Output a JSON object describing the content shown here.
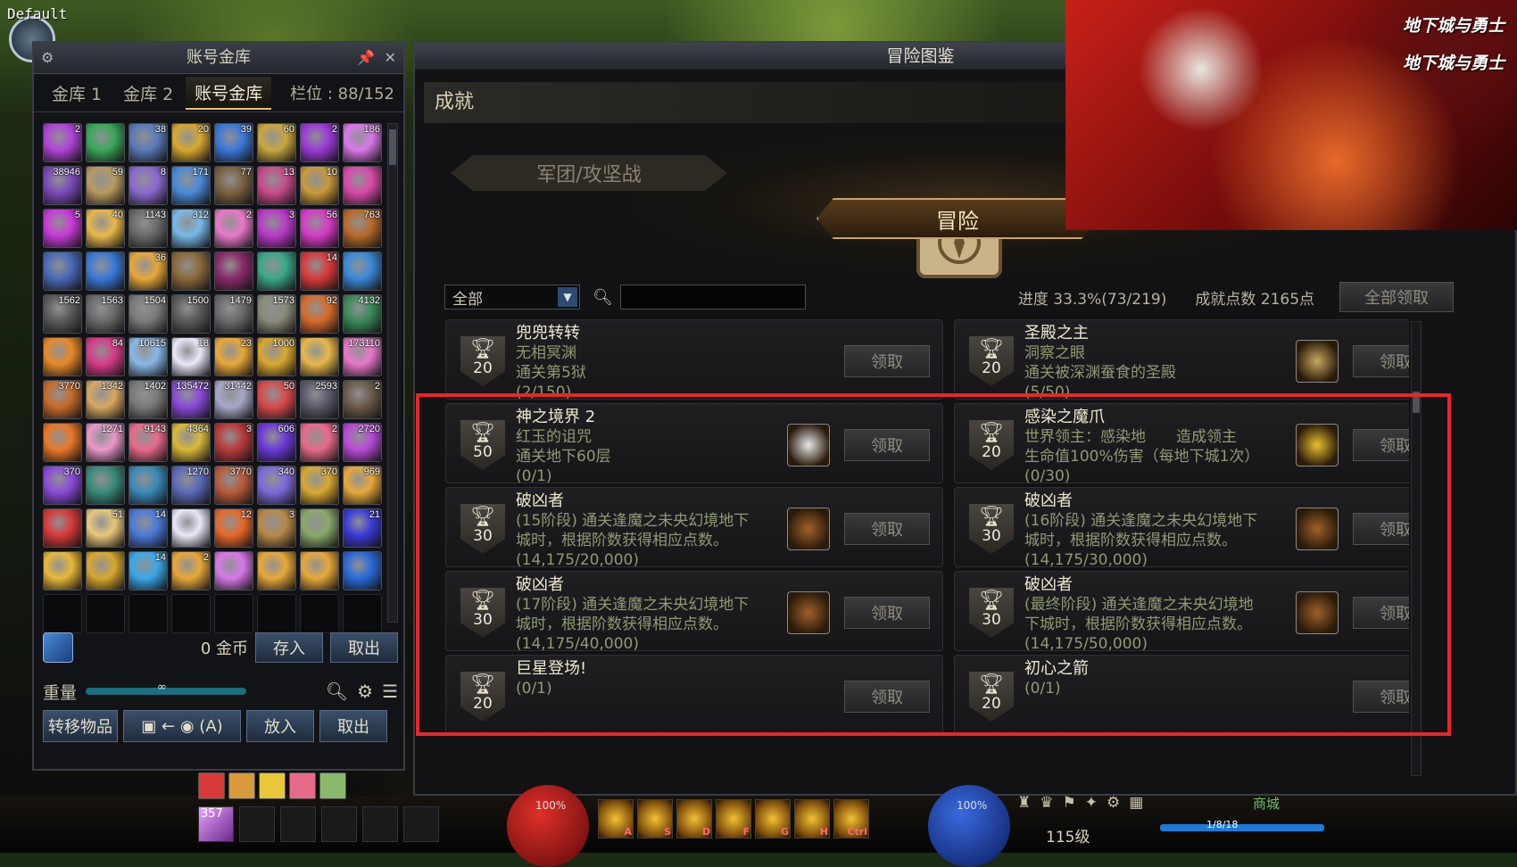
{
  "overlay": {
    "profile_tag": "Default",
    "logo_1": "地下城与勇士",
    "logo_2": "地下城与勇士"
  },
  "vault": {
    "title": "账号金库",
    "tabs": [
      "金库 1",
      "金库 2",
      "账号金库"
    ],
    "active_tab": 2,
    "slot_label": "栏位 : 88/152",
    "items": [
      {
        "n": "2",
        "c": "#b044d8"
      },
      {
        "n": "",
        "c": "#3aa85a"
      },
      {
        "n": "38",
        "c": "#5a7ab8"
      },
      {
        "n": "20",
        "c": "#d8a830"
      },
      {
        "n": "39",
        "c": "#3a78d8"
      },
      {
        "n": "60",
        "c": "#c8a840"
      },
      {
        "n": "2",
        "c": "#9a3ad8"
      },
      {
        "n": "186",
        "c": "#d878e8"
      },
      {
        "n": "38946",
        "c": "#7a4ab8"
      },
      {
        "n": "59",
        "c": "#b89a60"
      },
      {
        "n": "8",
        "c": "#8a6ad0"
      },
      {
        "n": "171",
        "c": "#4a8ad8"
      },
      {
        "n": "77",
        "c": "#7a6040"
      },
      {
        "n": "13",
        "c": "#c84a8a"
      },
      {
        "n": "10",
        "c": "#c89a3a"
      },
      {
        "n": "",
        "c": "#d84aa8"
      },
      {
        "n": "5",
        "c": "#c83ad8"
      },
      {
        "n": "40",
        "c": "#e8b84a"
      },
      {
        "n": "1143",
        "c": "#6a6a6a"
      },
      {
        "n": "312",
        "c": "#7ab8e8"
      },
      {
        "n": "2",
        "c": "#e878c8"
      },
      {
        "n": "3",
        "c": "#b83ac8"
      },
      {
        "n": "56",
        "c": "#d83ac8"
      },
      {
        "n": "763",
        "c": "#b86a2a"
      },
      {
        "n": "",
        "c": "#4a6ab8"
      },
      {
        "n": "",
        "c": "#3a7ad8"
      },
      {
        "n": "36",
        "c": "#e8a83a"
      },
      {
        "n": "",
        "c": "#8a6a3a"
      },
      {
        "n": "",
        "c": "#8a2a6a"
      },
      {
        "n": "",
        "c": "#3aa88a"
      },
      {
        "n": "14",
        "c": "#d83a3a"
      },
      {
        "n": "",
        "c": "#3a8ad8"
      },
      {
        "n": "1562",
        "c": "#5a5a5a"
      },
      {
        "n": "1563",
        "c": "#6a6a6a"
      },
      {
        "n": "1504",
        "c": "#7a7a7a"
      },
      {
        "n": "1500",
        "c": "#5a5a5a"
      },
      {
        "n": "1479",
        "c": "#6a6a6a"
      },
      {
        "n": "1573",
        "c": "#8a8a7a"
      },
      {
        "n": "92",
        "c": "#d86a2a"
      },
      {
        "n": "4132",
        "c": "#3a8a5a"
      },
      {
        "n": "",
        "c": "#e88a2a"
      },
      {
        "n": "84",
        "c": "#d83a8a"
      },
      {
        "n": "10615",
        "c": "#8ab8e8"
      },
      {
        "n": "18",
        "c": "#e8e8f8"
      },
      {
        "n": "23",
        "c": "#e8a83a"
      },
      {
        "n": "1000",
        "c": "#d8a830"
      },
      {
        "n": "",
        "c": "#e8b84a"
      },
      {
        "n": "173110",
        "c": "#e878c8"
      },
      {
        "n": "3770",
        "c": "#c86a2a"
      },
      {
        "n": "1342",
        "c": "#d8a860"
      },
      {
        "n": "1402",
        "c": "#7a7a7a"
      },
      {
        "n": "135472",
        "c": "#8a4ad8"
      },
      {
        "n": "31442",
        "c": "#a8a8c8"
      },
      {
        "n": "50",
        "c": "#d84a4a"
      },
      {
        "n": "2593",
        "c": "#5a5a6a"
      },
      {
        "n": "2",
        "c": "#6a5a4a"
      },
      {
        "n": "",
        "c": "#e8782a"
      },
      {
        "n": "1271",
        "c": "#e898c8"
      },
      {
        "n": "9143",
        "c": "#e86a8a"
      },
      {
        "n": "4364",
        "c": "#d8b83a"
      },
      {
        "n": "3",
        "c": "#b83a3a"
      },
      {
        "n": "606",
        "c": "#6a3ad8"
      },
      {
        "n": "2",
        "c": "#e86a8a"
      },
      {
        "n": "2720",
        "c": "#b84ad8"
      },
      {
        "n": "370",
        "c": "#8a4ad8"
      },
      {
        "n": "",
        "c": "#3a8a7a"
      },
      {
        "n": "",
        "c": "#3a8ab8"
      },
      {
        "n": "1270",
        "c": "#5a6ab8"
      },
      {
        "n": "3770",
        "c": "#b85a3a"
      },
      {
        "n": "340",
        "c": "#7a6ad8"
      },
      {
        "n": "370",
        "c": "#d8a830"
      },
      {
        "n": "969",
        "c": "#e8a83a"
      },
      {
        "n": "",
        "c": "#d83a3a"
      },
      {
        "n": "51",
        "c": "#e8c87a"
      },
      {
        "n": "14",
        "c": "#4a7ad8"
      },
      {
        "n": "",
        "c": "#e8e8f8"
      },
      {
        "n": "12",
        "c": "#e8682a"
      },
      {
        "n": "3",
        "c": "#b8884a"
      },
      {
        "n": "",
        "c": "#8aa86a"
      },
      {
        "n": "21",
        "c": "#3a3ad8"
      },
      {
        "n": "",
        "c": "#e8b83a"
      },
      {
        "n": "",
        "c": "#d8a830"
      },
      {
        "n": "14",
        "c": "#3aa8e8"
      },
      {
        "n": "2",
        "c": "#e8a83a"
      },
      {
        "n": "",
        "c": "#d878e8"
      },
      {
        "n": "",
        "c": "#e8a83a"
      },
      {
        "n": "",
        "c": "#e8a83a"
      },
      {
        "n": "",
        "c": "#2a6ad8"
      },
      {
        "n": "",
        "c": ""
      },
      {
        "n": "",
        "c": ""
      },
      {
        "n": "",
        "c": ""
      },
      {
        "n": "",
        "c": ""
      },
      {
        "n": "",
        "c": ""
      },
      {
        "n": "",
        "c": ""
      },
      {
        "n": "",
        "c": ""
      },
      {
        "n": "",
        "c": ""
      }
    ],
    "gold_amount": "0 金币",
    "deposit_label": "存入",
    "withdraw_label": "取出",
    "weight_label": "重量",
    "weight_value": "∞",
    "transfer_label": "转移物品",
    "transfer_mode": "(A)",
    "put_label": "放入",
    "take_label": "取出"
  },
  "encyclopedia": {
    "title": "冒险图鉴",
    "section_title": "成就",
    "tab_legion": "军团/攻坚战",
    "tab_adventure": "冒险",
    "filter_value": "全部",
    "search_placeholder": "",
    "progress_text": "进度 33.3%(73/219)",
    "points_text": "成就点数 2165点",
    "claim_all_label": "全部领取",
    "claim_label": "领取",
    "achievements": [
      {
        "title": "兜兜转转",
        "lines": [
          "无相冥渊",
          "通关第5狱",
          "(2/150)"
        ],
        "points": "20",
        "icon": ""
      },
      {
        "title": "圣殿之主",
        "lines": [
          "洞察之眼",
          "通关被深渊蚕食的圣殿",
          "(5/50)"
        ],
        "points": "20",
        "icon": "#c8a860"
      },
      {
        "title": "神之境界 2",
        "lines": [
          "红玉的诅咒",
          "通关地下60层",
          "(0/1)"
        ],
        "points": "50",
        "icon": "#e8e8e8"
      },
      {
        "title": "感染之魔爪",
        "lines": [
          "世界领主：感染地　　造成领主",
          "生命值100%伤害（每地下城1次）",
          "(0/30)"
        ],
        "points": "20",
        "icon": "#e8c030"
      },
      {
        "title": "破凶者",
        "lines": [
          "(15阶段) 通关逢魔之未央幻境地下",
          "城时，根据阶数获得相应点数。",
          "(14,175/20,000)"
        ],
        "points": "30",
        "icon": "#a0602a"
      },
      {
        "title": "破凶者",
        "lines": [
          "(16阶段) 通关逢魔之未央幻境地下",
          "城时，根据阶数获得相应点数。",
          "(14,175/30,000)"
        ],
        "points": "30",
        "icon": "#a0602a"
      },
      {
        "title": "破凶者",
        "lines": [
          "(17阶段) 通关逢魔之未央幻境地下",
          "城时，根据阶数获得相应点数。",
          "(14,175/40,000)"
        ],
        "points": "30",
        "icon": "#a0602a"
      },
      {
        "title": "破凶者",
        "lines": [
          "(最终阶段) 通关逢魔之未央幻境地",
          "下城时，根据阶数获得相应点数。",
          "(14,175/50,000)"
        ],
        "points": "30",
        "icon": "#a0602a"
      },
      {
        "title": "巨星登场!",
        "lines": [
          "(0/1)"
        ],
        "points": "20",
        "icon": ""
      },
      {
        "title": "初心之箭",
        "lines": [
          "(0/1)"
        ],
        "points": "20",
        "icon": ""
      }
    ]
  },
  "hud": {
    "hp_text": "100%",
    "mp_text": "100%",
    "skills": [
      {
        "k": "A"
      },
      {
        "k": "S"
      },
      {
        "k": "D"
      },
      {
        "k": "F"
      },
      {
        "k": "G"
      },
      {
        "k": "H"
      },
      {
        "k": "Ctrl"
      }
    ],
    "quick_slot_count": "357",
    "level_text": "115级",
    "exp_text": "1/8/18",
    "shop_label": "商城"
  }
}
